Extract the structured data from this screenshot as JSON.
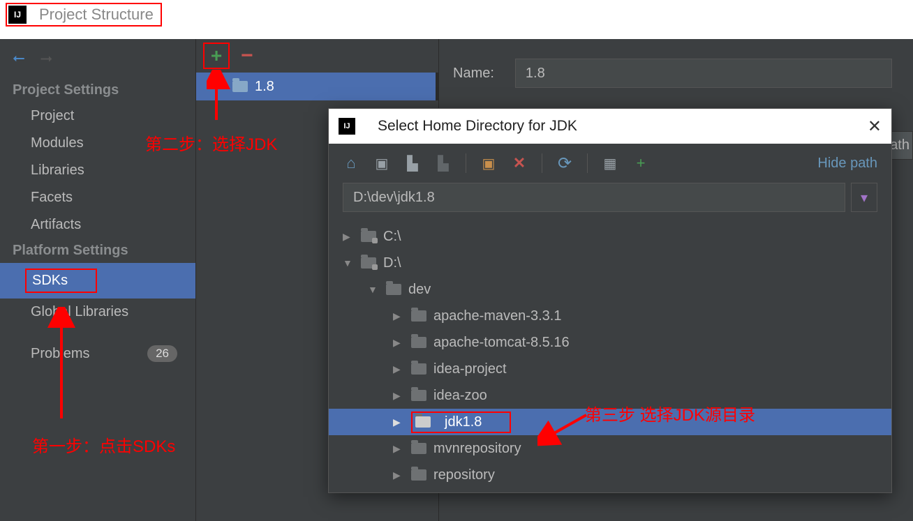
{
  "window": {
    "title": "Project Structure"
  },
  "sidebar": {
    "project_settings_header": "Project Settings",
    "platform_settings_header": "Platform Settings",
    "items": {
      "project": "Project",
      "modules": "Modules",
      "libraries": "Libraries",
      "facets": "Facets",
      "artifacts": "Artifacts",
      "sdks": "SDKs",
      "global_libraries": "Global Libraries",
      "problems": "Problems"
    },
    "problems_count": "26"
  },
  "sdk_list": {
    "selected": "1.8"
  },
  "details": {
    "name_label": "Name:",
    "name_value": "1.8",
    "partial_tab": "ath"
  },
  "dialog": {
    "title": "Select Home Directory for JDK",
    "hide_path": "Hide path",
    "path": "D:\\dev\\jdk1.8",
    "tree": {
      "c_drive": "C:\\",
      "d_drive": "D:\\",
      "dev": "dev",
      "children": [
        "apache-maven-3.3.1",
        "apache-tomcat-8.5.16",
        "idea-project",
        "idea-zoo",
        "jdk1.8",
        "mvnrepository",
        "repository"
      ]
    }
  },
  "annotations": {
    "step1": "第一步：点击SDKs",
    "step2": "第二步：选择JDK",
    "step3": "第三步 选择JDK源目录"
  }
}
